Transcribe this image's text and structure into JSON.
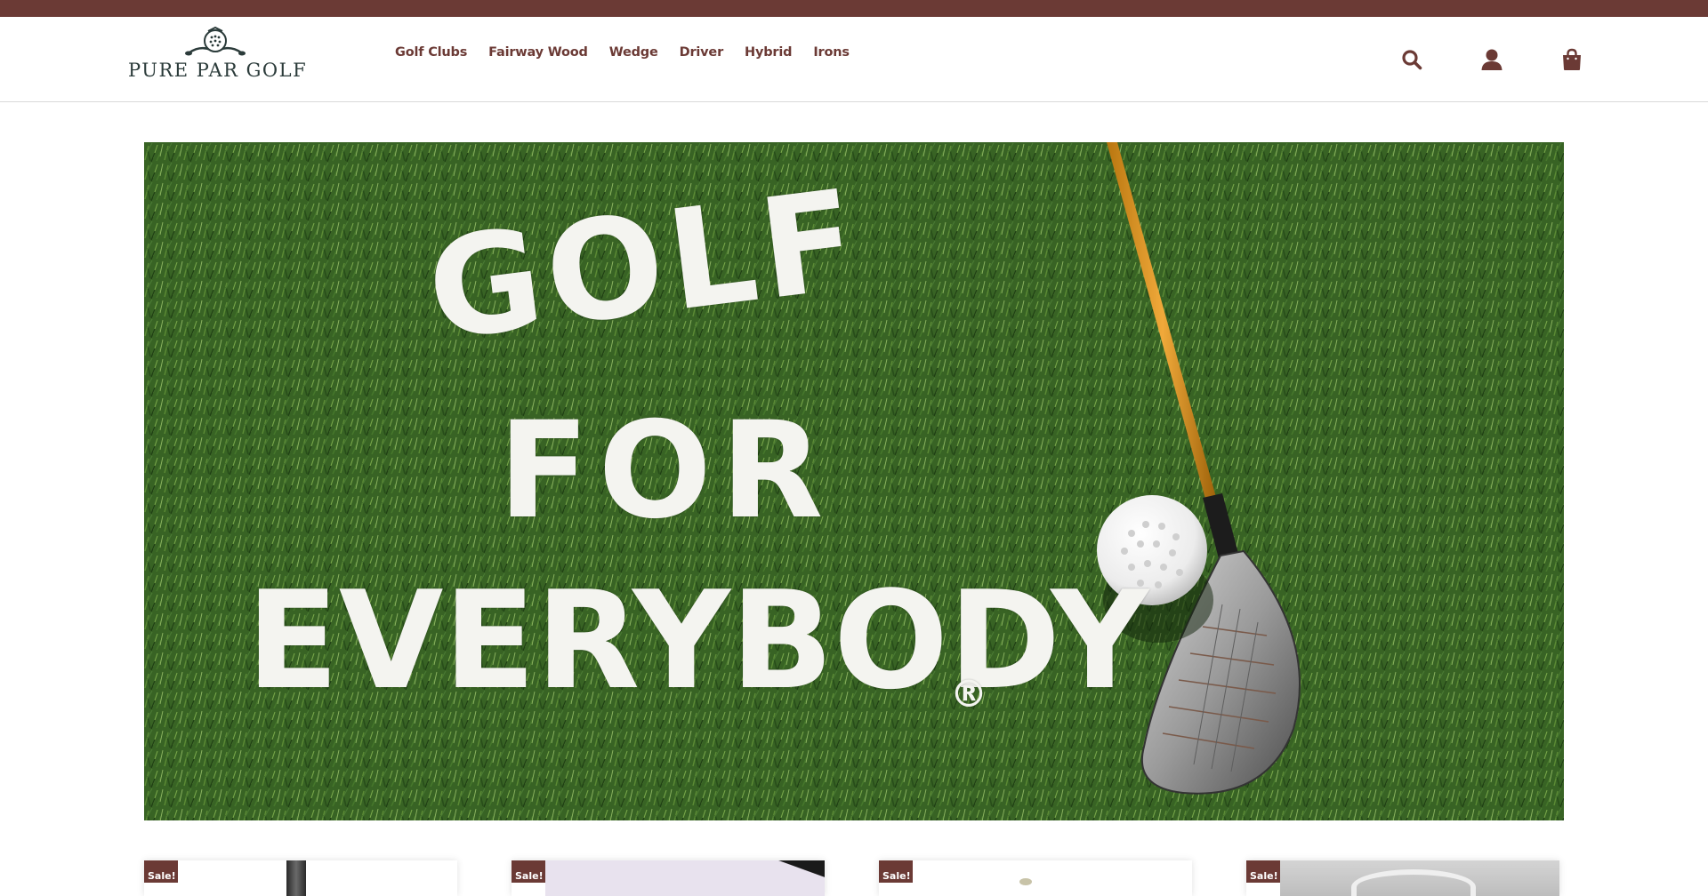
{
  "brand": {
    "name": "PURE PAR GOLF",
    "emblem_icon": "golf-ball-crossed-clubs-emblem",
    "top_bar_color": "#6b3a35",
    "accent_color": "#6b3a35"
  },
  "nav": {
    "items": [
      {
        "label": "Golf Clubs"
      },
      {
        "label": "Fairway Wood"
      },
      {
        "label": "Wedge"
      },
      {
        "label": "Driver"
      },
      {
        "label": "Hybrid"
      },
      {
        "label": "Irons"
      }
    ]
  },
  "header_icons": {
    "search": "search-icon",
    "account": "user-icon",
    "cart": "shopping-bag-icon"
  },
  "hero": {
    "line1": "GOLF",
    "line2": "FOR",
    "line3": "EVERYBODY",
    "registered": "®"
  },
  "products": [
    {
      "badge": "Sale!"
    },
    {
      "badge": "Sale!"
    },
    {
      "badge": "Sale!"
    },
    {
      "badge": "Sale!"
    }
  ]
}
